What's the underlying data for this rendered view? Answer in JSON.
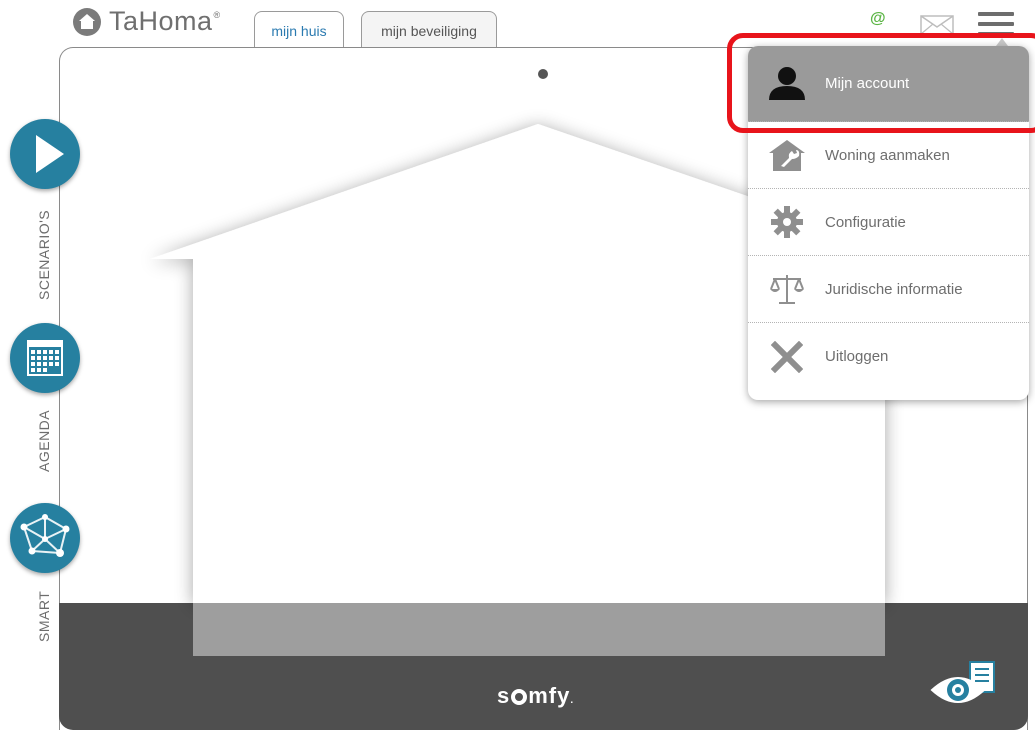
{
  "header": {
    "app_name": "TaHoma",
    "app_reg": "®",
    "tabs": [
      {
        "label": "mijn huis",
        "active": true
      },
      {
        "label": "mijn beveiliging",
        "active": false
      }
    ],
    "at_symbol": "@"
  },
  "sidebar": {
    "items": [
      {
        "label": "SCENARIO'S",
        "icon": "play-icon"
      },
      {
        "label": "AGENDA",
        "icon": "calendar-icon"
      },
      {
        "label": "SMART",
        "icon": "network-icon"
      }
    ]
  },
  "brand": {
    "footer_logo_pre": "s",
    "footer_logo_post": "mfy",
    "footer_logo_dot": "."
  },
  "menu": {
    "items": [
      {
        "label": "Mijn account",
        "icon": "user-icon",
        "active": true
      },
      {
        "label": "Woning aanmaken",
        "icon": "house-wrench-icon",
        "active": false
      },
      {
        "label": "Configuratie",
        "icon": "gear-icon",
        "active": false
      },
      {
        "label": "Juridische informatie",
        "icon": "scales-icon",
        "active": false
      },
      {
        "label": "Uitloggen",
        "icon": "close-icon",
        "active": false
      }
    ]
  },
  "colors": {
    "accent": "#2680a0",
    "highlight": "#e8141b",
    "footer": "#4f4f4f",
    "at_green": "#5bb545"
  }
}
